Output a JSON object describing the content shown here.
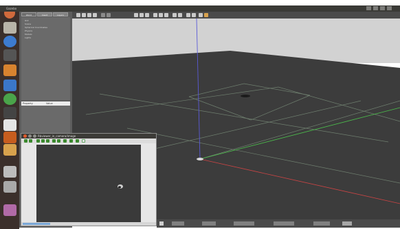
{
  "window": {
    "title": "Gazebo",
    "menu_title": "Gazebo"
  },
  "left_panel": {
    "tabs": [
      "World",
      "Insert",
      "Layers"
    ],
    "tree_items": [
      "GUI",
      "Scene",
      "Spherical Coordinates",
      "Physics",
      "Models",
      "Lights"
    ],
    "property_header": {
      "col1": "Property",
      "col2": "Value"
    }
  },
  "camera_window": {
    "title": "Rbviewer_in_camera/image"
  },
  "statusbar": {
    "labels": [
      "Steps",
      "Real Time Factor",
      "Sim Time",
      "Real Time",
      "Iterations",
      "Reset Time"
    ]
  },
  "colors": {
    "sky": "#d2d2d2",
    "ground": "#3a3a3a",
    "grid": "#6f7f6f",
    "x_axis": "#4cbf4c",
    "y_axis": "#cc4444",
    "z_axis": "#5a5ad8"
  }
}
